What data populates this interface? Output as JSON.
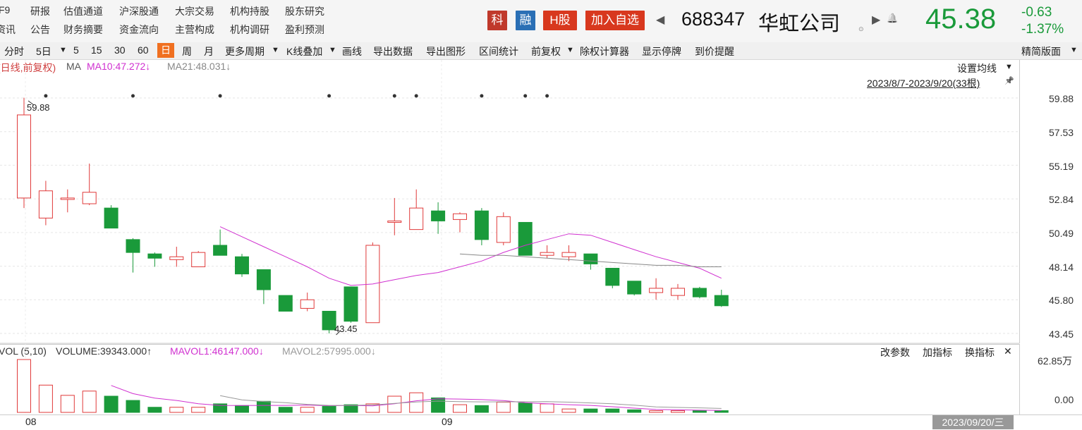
{
  "nav": {
    "row1": [
      "F9",
      "研报",
      "估值通道",
      "沪深股通",
      "大宗交易",
      "机构持股",
      "股东研究"
    ],
    "row2": [
      "资讯",
      "公告",
      "财务摘要",
      "资金流向",
      "主营构成",
      "机构调研",
      "盈利预测"
    ]
  },
  "header": {
    "tags": [
      {
        "label": "科",
        "color": "#c0392b"
      },
      {
        "label": "融",
        "color": "#2a6fb5"
      },
      {
        "label": "H股",
        "color": "#d8381e"
      },
      {
        "label": "加入自选",
        "color": "#d8381e"
      }
    ],
    "prev_arrow": "◀",
    "code": "688347",
    "name": "华虹公司",
    "info_icon": "⊙",
    "next_arrow": "▶",
    "bell_icon": "🔔",
    "price": "45.38",
    "change": "-0.63",
    "change_pct": "-1.37%"
  },
  "toolbar": {
    "items": [
      "分时",
      "5日",
      "▼",
      "5",
      "15",
      "30",
      "60",
      "日",
      "周",
      "月",
      "更多周期",
      "▼",
      "K线叠加",
      "▼",
      "画线",
      "导出数据",
      "导出图形",
      "区间统计",
      "前复权",
      "▼",
      "除权计算器",
      "显示停牌",
      "到价提醒"
    ],
    "right": "精简版面",
    "right_arrow": "▼"
  },
  "legend": {
    "period": "(日线,前复权)",
    "ma": "MA",
    "ma10": "MA10:47.272↓",
    "ma21": "MA21:48.031↓",
    "settings": "设置均线",
    "settings_arrow": "▼",
    "range": "2023/8/7-2023/9/20(33根)",
    "pin_icon": "📌"
  },
  "vol_legend": {
    "label": "VOL (5,10)",
    "volume": "VOLUME:39343.000↑",
    "mavol1": "MAVOL1:46147.000↓",
    "mavol2": "MAVOL2:57995.000↓",
    "params": "改参数",
    "add": "加指标",
    "switch": "换指标",
    "close": "✕"
  },
  "axis": {
    "price_ticks": [
      "59.88",
      "57.53",
      "55.19",
      "52.84",
      "50.49",
      "48.14",
      "45.80",
      "43.45"
    ],
    "vol_ticks": [
      "62.85万",
      "0.00"
    ]
  },
  "dates": {
    "aug": "08",
    "sep": "09",
    "current": "2023/09/20/三"
  },
  "chart_data": {
    "type": "candlestick",
    "ylim": [
      43.45,
      59.88
    ],
    "high_label": "59.88",
    "low_label": "43.45",
    "candles": [
      {
        "o": 52.9,
        "c": 58.7,
        "h": 59.9,
        "l": 52.2
      },
      {
        "o": 51.5,
        "c": 53.4,
        "h": 54.1,
        "l": 51.0
      },
      {
        "o": 52.8,
        "c": 52.9,
        "h": 53.5,
        "l": 51.9
      },
      {
        "o": 52.5,
        "c": 53.3,
        "h": 55.3,
        "l": 52.4
      },
      {
        "o": 52.2,
        "c": 50.8,
        "h": 52.4,
        "l": 50.8
      },
      {
        "o": 50.0,
        "c": 49.1,
        "h": 50.1,
        "l": 47.7
      },
      {
        "o": 49.0,
        "c": 48.7,
        "h": 49.1,
        "l": 48.1
      },
      {
        "o": 48.6,
        "c": 48.8,
        "h": 49.5,
        "l": 48.1
      },
      {
        "o": 48.1,
        "c": 49.1,
        "h": 49.2,
        "l": 48.1
      },
      {
        "o": 49.6,
        "c": 48.9,
        "h": 50.7,
        "l": 48.9
      },
      {
        "o": 48.8,
        "c": 47.6,
        "h": 49.0,
        "l": 47.4
      },
      {
        "o": 47.9,
        "c": 46.5,
        "h": 47.9,
        "l": 45.5
      },
      {
        "o": 46.1,
        "c": 45.0,
        "h": 46.1,
        "l": 45.0
      },
      {
        "o": 45.2,
        "c": 45.8,
        "h": 46.3,
        "l": 45.0
      },
      {
        "o": 45.0,
        "c": 43.7,
        "h": 45.0,
        "l": 43.45
      },
      {
        "o": 46.7,
        "c": 44.3,
        "h": 46.7,
        "l": 44.2
      },
      {
        "o": 44.2,
        "c": 49.6,
        "h": 49.8,
        "l": 44.2
      },
      {
        "o": 51.2,
        "c": 51.3,
        "h": 52.9,
        "l": 50.3
      },
      {
        "o": 50.7,
        "c": 52.2,
        "h": 53.5,
        "l": 50.7
      },
      {
        "o": 52.0,
        "c": 51.3,
        "h": 52.6,
        "l": 50.4
      },
      {
        "o": 51.4,
        "c": 51.8,
        "h": 51.9,
        "l": 50.5
      },
      {
        "o": 52.0,
        "c": 50.0,
        "h": 52.2,
        "l": 49.6
      },
      {
        "o": 49.8,
        "c": 51.6,
        "h": 51.9,
        "l": 49.6
      },
      {
        "o": 51.2,
        "c": 48.9,
        "h": 51.2,
        "l": 48.9
      },
      {
        "o": 48.9,
        "c": 49.1,
        "h": 49.6,
        "l": 48.7
      },
      {
        "o": 48.8,
        "c": 49.1,
        "h": 49.6,
        "l": 48.5
      },
      {
        "o": 49.0,
        "c": 48.3,
        "h": 49.0,
        "l": 47.9
      },
      {
        "o": 48.0,
        "c": 46.8,
        "h": 48.0,
        "l": 46.6
      },
      {
        "o": 47.1,
        "c": 46.2,
        "h": 47.1,
        "l": 46.1
      },
      {
        "o": 46.3,
        "c": 46.6,
        "h": 47.3,
        "l": 45.8
      },
      {
        "o": 46.1,
        "c": 46.6,
        "h": 46.9,
        "l": 45.8
      },
      {
        "o": 46.6,
        "c": 46.0,
        "h": 46.7,
        "l": 45.9
      },
      {
        "o": 46.1,
        "c": 45.38,
        "h": 46.5,
        "l": 45.3
      }
    ],
    "ma10": [
      null,
      null,
      null,
      null,
      null,
      null,
      null,
      null,
      null,
      50.9,
      50.2,
      49.5,
      48.8,
      48.1,
      47.3,
      46.8,
      46.9,
      47.2,
      47.5,
      47.7,
      48.1,
      48.5,
      49.1,
      49.6,
      50.0,
      50.4,
      50.3,
      49.8,
      49.3,
      48.8,
      48.4,
      48.0,
      47.3
    ],
    "ma21": [
      null,
      null,
      null,
      null,
      null,
      null,
      null,
      null,
      null,
      null,
      null,
      null,
      null,
      null,
      null,
      null,
      null,
      null,
      null,
      null,
      49.0,
      48.9,
      48.9,
      48.8,
      48.7,
      48.6,
      48.5,
      48.4,
      48.3,
      48.2,
      48.2,
      48.1,
      48.1
    ],
    "volume": [
      62.0,
      32.0,
      20.0,
      25.0,
      19.0,
      14.0,
      6.0,
      6.0,
      6.0,
      10.0,
      8.0,
      13.0,
      6.0,
      6.0,
      7.0,
      9.0,
      10.0,
      19.0,
      23.0,
      17.0,
      9.0,
      8.0,
      12.0,
      11.0,
      10.0,
      4.0,
      4.0,
      4.0,
      3.0,
      2.0,
      2.0,
      2.0,
      2.0
    ],
    "mavol1": [
      null,
      null,
      null,
      null,
      31.6,
      22.0,
      16.8,
      14.0,
      10.2,
      8.2,
      8.0,
      8.2,
      8.2,
      8.6,
      7.8,
      8.2,
      7.6,
      10.2,
      13.6,
      16.0,
      15.6,
      15.0,
      13.8,
      11.4,
      10.0,
      9.0,
      8.2,
      6.6,
      5.0,
      3.4,
      3.0,
      2.6,
      2.2
    ],
    "mavol2": [
      null,
      null,
      null,
      null,
      null,
      null,
      null,
      null,
      null,
      19.7,
      14.6,
      12.7,
      11.3,
      9.4,
      8.2,
      8.2,
      8.7,
      10.5,
      12.2,
      13.2,
      12.6,
      12.3,
      12.4,
      12.5,
      12.6,
      12.0,
      11.1,
      10.1,
      8.4,
      6.4,
      5.8,
      5.3,
      4.6
    ],
    "vol_max": 62.85,
    "markers": [
      1,
      5,
      9,
      14,
      17,
      18,
      21,
      23,
      24
    ]
  }
}
